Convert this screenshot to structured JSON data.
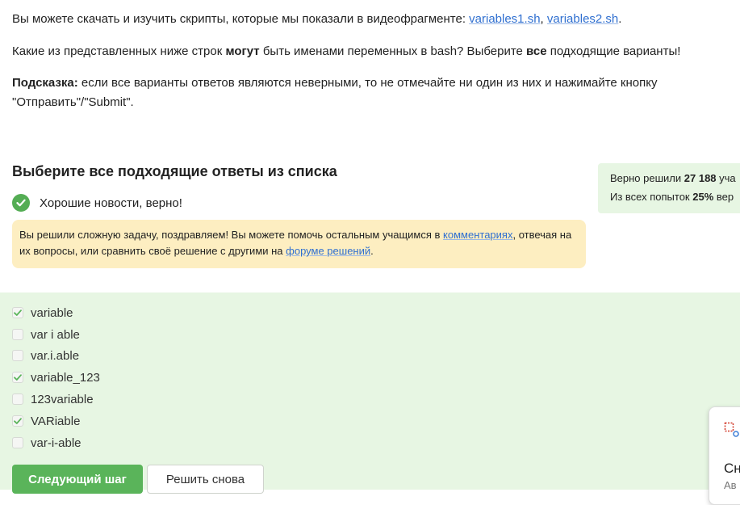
{
  "intro": {
    "text": "Вы можете скачать и изучить скрипты, которые мы показали в видеофрагменте: ",
    "link1": "variables1.sh",
    "sep": ", ",
    "link2": "variables2.sh",
    "end": "."
  },
  "question": {
    "part1": "Какие из представленных ниже строк ",
    "bold1": "могут",
    "part2": " быть именами переменных в bash? Выберите ",
    "bold2": "все",
    "part3": " подходящие варианты!"
  },
  "hint": {
    "label": "Подсказка:",
    "text": " если все варианты ответов являются неверными, то не отмечайте ни один из них и нажимайте кнопку \"Отправить\"/\"Submit\"."
  },
  "quiz": {
    "title": "Выберите все подходящие ответы из списка",
    "result": "Хорошие новости, верно!"
  },
  "congrats": {
    "part1": "Вы решили сложную задачу, поздравляем! Вы можете помочь остальным учащимся в ",
    "link1": "комментариях",
    "part2": ", отвечая на их вопросы, или сравнить своё решение с другими на ",
    "link2": "форуме решений",
    "end": "."
  },
  "stats": {
    "line1_prefix": "Верно решили ",
    "line1_value": "27 188",
    "line1_suffix": " уча",
    "line2_prefix": "Из всех попыток ",
    "line2_value": "25%",
    "line2_suffix": " вер"
  },
  "options": [
    {
      "label": "variable",
      "checked": true
    },
    {
      "label": "var i able",
      "checked": false
    },
    {
      "label": "var.i.able",
      "checked": false
    },
    {
      "label": "variable_123",
      "checked": true
    },
    {
      "label": "123variable",
      "checked": false
    },
    {
      "label": "VARiable",
      "checked": true
    },
    {
      "label": "var-i-able",
      "checked": false
    }
  ],
  "buttons": {
    "next": "Следующий шаг",
    "retry": "Решить снова"
  },
  "popup": {
    "title": "Сн",
    "subtitle": "Ав"
  },
  "colors": {
    "link": "#2f6fd0",
    "success": "#54ad54",
    "options_bg": "#e7f6e3",
    "congrats_bg": "#fdeec1"
  }
}
